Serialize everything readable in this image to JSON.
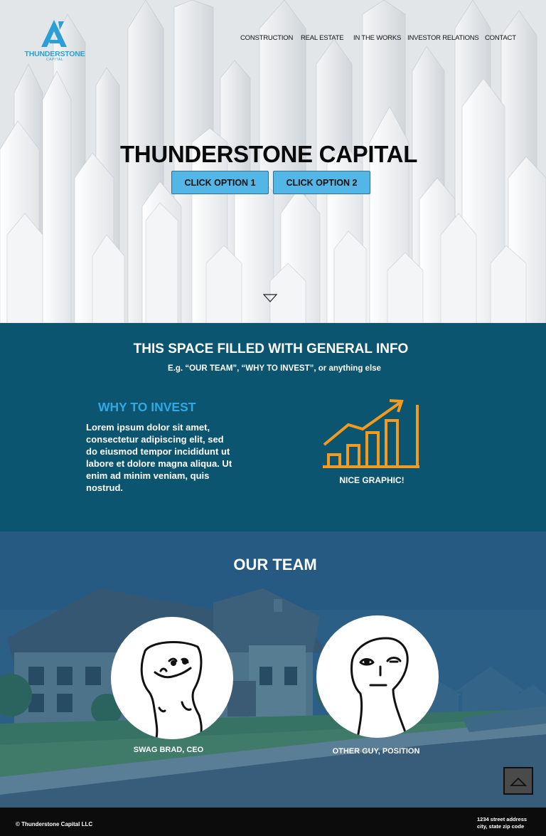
{
  "brand": {
    "name": "THUNDERSTONE",
    "sub": "CAPITAL",
    "accent": "#2a9fd8"
  },
  "nav": {
    "items": [
      {
        "label": "CONSTRUCTION"
      },
      {
        "label": "REAL ESTATE"
      },
      {
        "label": "IN THE WORKS"
      },
      {
        "label": "INVESTOR RELATIONS"
      },
      {
        "label": "CONTACT"
      }
    ]
  },
  "hero": {
    "title": "THUNDERSTONE CAPITAL",
    "buttons": [
      {
        "label": "CLICK OPTION 1"
      },
      {
        "label": "CLICK OPTION 2"
      }
    ],
    "button_color": "#52b6e6",
    "scroll_icon": "chevron-down-icon"
  },
  "info": {
    "title": "THIS SPACE FILLED WITH GENERAL INFO",
    "subtitle": "E.g. “OUR TEAM”,  “WHY TO INVEST”, or anything else",
    "why_title": "WHY TO INVEST",
    "why_body": "Lorem ipsum dolor sit amet, consectetur adipiscing elit, sed do eiusmod tempor incididunt ut labore et dolore magna aliqua. Ut enim ad minim veniam, quis nostrud.",
    "graphic_label": "NICE GRAPHIC!",
    "graphic_icon": "growth-chart-icon",
    "background": "#0b5570",
    "graphic_color": "#f39a1f"
  },
  "team": {
    "title": "OUR TEAM",
    "members": [
      {
        "label": "SWAG BRAD, CEO"
      },
      {
        "label": "OTHER GUY, POSITION"
      }
    ],
    "back_to_top_icon": "chevron-up-icon"
  },
  "footer": {
    "copyright": "© Thunderstone Capital LLC",
    "address_line1": "1234 street address",
    "address_line2": "city, state zip code"
  }
}
